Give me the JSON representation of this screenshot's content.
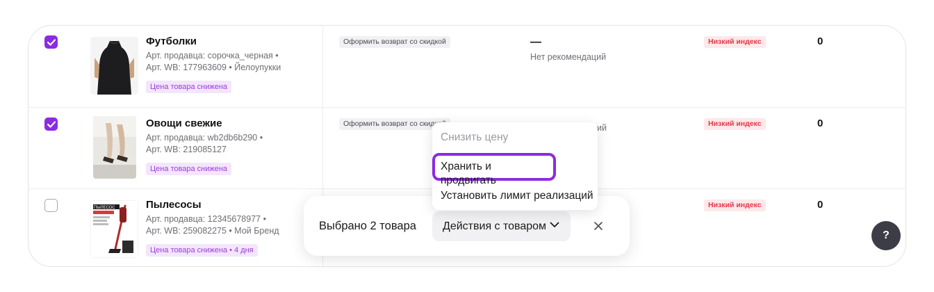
{
  "products": [
    {
      "name": "Футболки",
      "seller_art": "Арт. продавца: сорочка_черная •",
      "wb_art": "Арт. WB: 177963609 • Йелоупукки",
      "price_tag": "Цена товара снижена",
      "return_action": "Оформить возврат со скидкой",
      "reco_dash": "—",
      "reco_text": "Нет рекомендаций",
      "index_badge": "Низкий индекс",
      "count": "0",
      "checked": true,
      "thumb_icon": "black-tank-top-photo"
    },
    {
      "name": "Овощи свежие",
      "seller_art": "Арт. продавца: wb2db6b290 •",
      "wb_art": "Арт. WB: 219085127",
      "price_tag": "Цена товара снижена",
      "return_action": "Оформить возврат со скидкой",
      "reco_dash": "",
      "reco_text": "ий",
      "index_badge": "Низкий индекс",
      "count": "0",
      "checked": true,
      "thumb_icon": "legs-photo"
    },
    {
      "name": "Пылесосы",
      "seller_art": "Арт. продавца: 12345678977 •",
      "wb_art": "Арт. WB: 259082275 • Мой Бренд",
      "price_tag": "Цена товара снижена • 4 дня",
      "index_badge": "Низкий индекс",
      "count": "0",
      "checked": false,
      "thumb_icon": "vacuum-cleaner-photo",
      "thumb_text": "ПЫЛЕСОС"
    }
  ],
  "dropdown": {
    "items": [
      "Снизить цену",
      "Хранить и продвигать",
      "Установить лимит реализаций"
    ],
    "disabled_item": "Снизить цену",
    "highlighted_item": "Хранить и продвигать"
  },
  "action_bar": {
    "selected_text": "Выбрано 2 товара",
    "actions_label": "Действия с товаром",
    "close_icon": "close-icon"
  },
  "help": {
    "label": "?"
  },
  "colors": {
    "accent": "#8b2be2",
    "index_red": "#e5384a",
    "price_tag_purple": "#9b3dd8",
    "help_bg": "#3d3d48"
  }
}
